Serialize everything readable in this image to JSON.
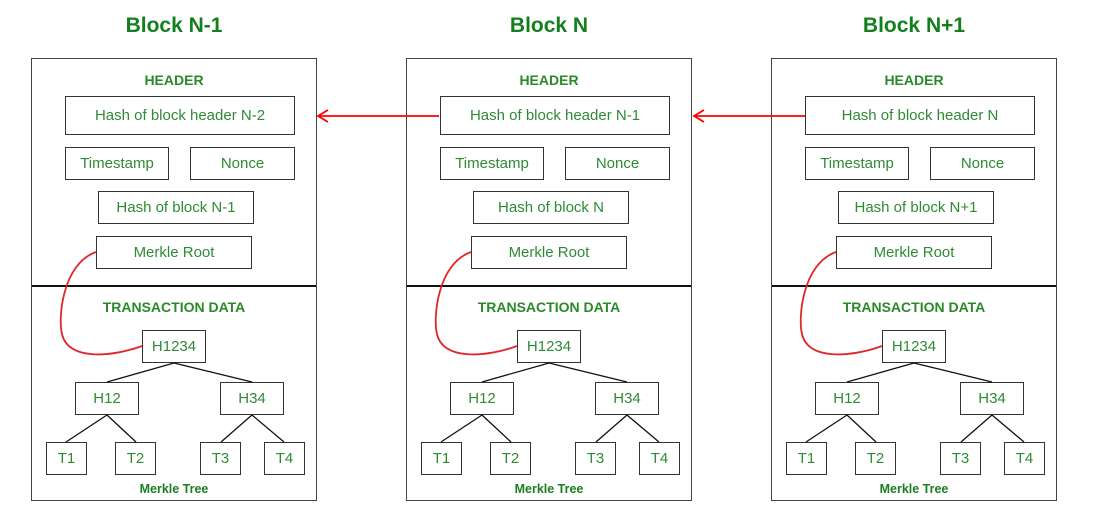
{
  "diagram": {
    "type": "blockchain-structure",
    "colors": {
      "title": "#137f1d",
      "text": "#2e8b34",
      "border": "#333333",
      "link": "#ff0000",
      "merkle_link": "#e0262a"
    },
    "blocks": [
      {
        "title": "Block N-1",
        "header_label": "HEADER",
        "prev_hash": "Hash of block header N-2",
        "timestamp": "Timestamp",
        "nonce": "Nonce",
        "block_hash": "Hash of block N-1",
        "merkle_root": "Merkle Root",
        "transaction_label": "TRANSACTION DATA",
        "tree": {
          "root": "H1234",
          "left": "H12",
          "right": "H34",
          "leaves": [
            "T1",
            "T2",
            "T3",
            "T4"
          ]
        },
        "tree_label": "Merkle Tree"
      },
      {
        "title": "Block N",
        "header_label": "HEADER",
        "prev_hash": "Hash of block header N-1",
        "timestamp": "Timestamp",
        "nonce": "Nonce",
        "block_hash": "Hash of block N",
        "merkle_root": "Merkle Root",
        "transaction_label": "TRANSACTION DATA",
        "tree": {
          "root": "H1234",
          "left": "H12",
          "right": "H34",
          "leaves": [
            "T1",
            "T2",
            "T3",
            "T4"
          ]
        },
        "tree_label": "Merkle Tree"
      },
      {
        "title": "Block N+1",
        "header_label": "HEADER",
        "prev_hash": "Hash of block header N",
        "timestamp": "Timestamp",
        "nonce": "Nonce",
        "block_hash": "Hash of block N+1",
        "merkle_root": "Merkle Root",
        "transaction_label": "TRANSACTION DATA",
        "tree": {
          "root": "H1234",
          "left": "H12",
          "right": "H34",
          "leaves": [
            "T1",
            "T2",
            "T3",
            "T4"
          ]
        },
        "tree_label": "Merkle Tree"
      }
    ],
    "links": [
      {
        "from": "Block N",
        "to": "Block N-1",
        "relation": "prev_hash"
      },
      {
        "from": "Block N+1",
        "to": "Block N",
        "relation": "prev_hash"
      }
    ]
  }
}
